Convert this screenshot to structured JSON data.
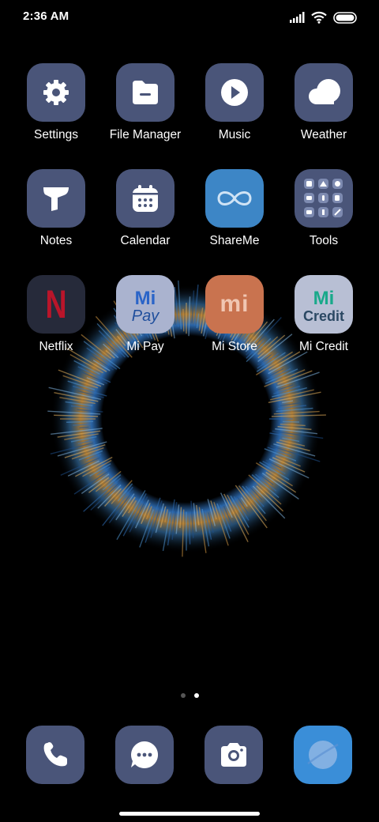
{
  "status_bar": {
    "time": "2:36 AM",
    "icons": [
      "signal-icon",
      "wifi-icon",
      "battery-icon"
    ]
  },
  "apps": [
    {
      "label": "Settings",
      "icon": "settings-gear-icon"
    },
    {
      "label": "File Manager",
      "icon": "folder-icon"
    },
    {
      "label": "Music",
      "icon": "play-icon"
    },
    {
      "label": "Weather",
      "icon": "cloud-icon"
    },
    {
      "label": "Notes",
      "icon": "funnel-note-icon"
    },
    {
      "label": "Calendar",
      "icon": "calendar-icon"
    },
    {
      "label": "ShareMe",
      "icon": "infinity-icon"
    },
    {
      "label": "Tools",
      "icon": "tools-grid-icon"
    },
    {
      "label": "Netflix",
      "icon": "netflix-n-icon",
      "logo_text": "N"
    },
    {
      "label": "Mi Pay",
      "icon": "mi-pay-logo-icon",
      "logo_text": [
        "Mi",
        "Pay"
      ]
    },
    {
      "label": "Mi Store",
      "icon": "mi-store-logo-icon",
      "logo_text": "mi"
    },
    {
      "label": "Mi Credit",
      "icon": "mi-credit-logo-icon",
      "logo_text": [
        "Mi",
        "Credit"
      ]
    }
  ],
  "page_indicator": {
    "pages": 2,
    "active_page": 2
  },
  "dock": [
    {
      "icon": "phone-icon"
    },
    {
      "icon": "messaging-icon"
    },
    {
      "icon": "camera-icon"
    },
    {
      "icon": "browser-icon"
    }
  ],
  "colors": {
    "tile": "#4a5579",
    "shareme": "#3d86c6",
    "netflix_red": "#b9152a",
    "mi_orange": "#e0744a",
    "mi_credit_green": "#19a98a",
    "browser": "#3a8ed8"
  }
}
